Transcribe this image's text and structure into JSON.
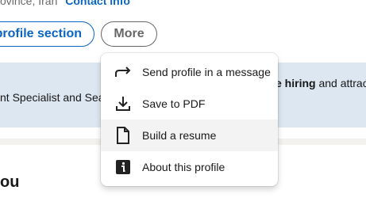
{
  "profile": {
    "location_fragment": "ovince, Iran",
    "contact_info": "Contact info",
    "section_button": "profile section",
    "more_button": "More",
    "about_heading": "ou"
  },
  "banner": {
    "left_text": "nt Specialist and Sear",
    "right_bold": "e hiring",
    "right_rest": " and attrac"
  },
  "menu": {
    "items": [
      {
        "label": "Send profile in a message",
        "icon": "share-arrow-icon"
      },
      {
        "label": "Save to PDF",
        "icon": "download-icon"
      },
      {
        "label": "Build a resume",
        "icon": "document-icon"
      },
      {
        "label": "About this profile",
        "icon": "info-icon"
      }
    ]
  },
  "colors": {
    "accent": "#0a66c2",
    "banner_bg": "#dde7f1",
    "menu_hover": "#f3f3f3"
  }
}
